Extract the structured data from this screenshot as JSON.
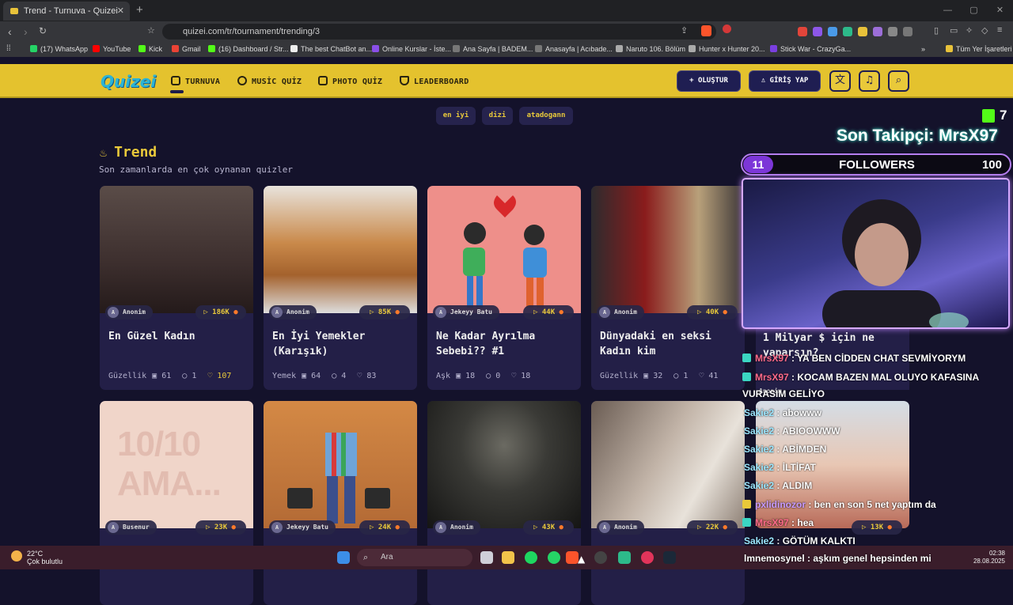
{
  "browser": {
    "tab_title": "Trend - Turnuva - Quizei",
    "tab_close": "✕",
    "new_tab": "+",
    "url": "quizei.com/tr/tournament/trending/3",
    "bookmarks": [
      "(17) WhatsApp",
      "YouTube",
      "Kick",
      "Gmail",
      "(16) Dashboard / Str...",
      "The best ChatBot an...",
      "Online Kurslar - İste...",
      "Ana Sayfa | BADEM...",
      "Anasayfa | Acıbade...",
      "Naruto 106. Bölüm",
      "Hunter x Hunter 20...",
      "Stick War - CrazyGa..."
    ],
    "all_bookmarks": "Tüm Yer İşaretleri",
    "more": "»"
  },
  "site": {
    "logo": "Quizei",
    "nav": [
      "TURNUVA",
      "MUSİC QUİZ",
      "PHOTO QUİZ",
      "LEADERBOARD"
    ],
    "create_button": "+ OLUŞTUR",
    "login_button": "GİRİŞ YAP",
    "tags": [
      "en iyi",
      "dizi",
      "atadogann"
    ],
    "trend_title": "Trend",
    "trend_subtitle": "Son zamanlarda en çok oynanan quizler"
  },
  "cards": [
    {
      "author": "Anonim",
      "plays": "186K",
      "title": "En Güzel Kadın",
      "category": "Güzellik",
      "questions": "61",
      "comments": "1",
      "likes": "107",
      "likes_highlight": true,
      "color": "#4a3b3a"
    },
    {
      "author": "Anonim",
      "plays": "85K",
      "title": "En İyi Yemekler (Karışık)",
      "category": "Yemek",
      "questions": "64",
      "comments": "4",
      "likes": "83",
      "likes_highlight": false,
      "color": "#b27942"
    },
    {
      "author": "Jekeyy Batu",
      "plays": "44K",
      "title": "Ne Kadar Ayrılma Sebebi?? #1",
      "category": "Aşk",
      "questions": "18",
      "comments": "0",
      "likes": "18",
      "likes_highlight": false,
      "color": "#ee8f8a"
    },
    {
      "author": "Anonim",
      "plays": "40K",
      "title": "Dünyadaki en seksi Kadın kim",
      "category": "Güzellik",
      "questions": "32",
      "comments": "1",
      "likes": "41",
      "likes_highlight": false,
      "color": "#5d2a2a"
    },
    {
      "author": "Busenur",
      "plays": "23K",
      "title": "",
      "color": "#f0d5c9",
      "image_text": "10/10 AMA..."
    },
    {
      "author": "Jekeyy Batu",
      "plays": "24K",
      "title": "",
      "color": "#c27a3d"
    },
    {
      "author": "Anonim",
      "plays": "43K",
      "title": "",
      "color": "#2a2a28"
    },
    {
      "author": "Anonim",
      "plays": "22K",
      "title": "",
      "color": "#a89a8e"
    }
  ],
  "hidden_card": {
    "plays": "13K",
    "author": "Anonim",
    "title": "1 Milyar $ için ne yaparsın?"
  },
  "stream": {
    "kick_count": "7",
    "last_follower": "Son Takipçi: MrsX97",
    "followers_current": "11",
    "followers_label": "FOLLOWERS",
    "followers_goal": "100",
    "chat": [
      {
        "user": "MrsX97",
        "text": " : YA BEN CİDDEN CHAT SEVMİYORYM",
        "color": "#ff6a8a",
        "icon": "#3bd6c2"
      },
      {
        "user": "MrsX97",
        "text": " : KOCAM BAZEN MAL OLUYO KAFASINA",
        "color": "#ff6a8a",
        "icon": "#3bd6c2"
      },
      {
        "user": "",
        "text": "VURASIM GELİYO",
        "color": "#ffffff",
        "icon": ""
      },
      {
        "user": "Sakie2",
        "text": " : abowww",
        "color": "#9be7ff",
        "icon": ""
      },
      {
        "user": "Sakie2",
        "text": " : ABIOOWWW",
        "color": "#9be7ff",
        "icon": ""
      },
      {
        "user": "Sakie2",
        "text": " : ABİMDEN",
        "color": "#9be7ff",
        "icon": ""
      },
      {
        "user": "Sakie2",
        "text": " : İLTİFAT",
        "color": "#9be7ff",
        "icon": ""
      },
      {
        "user": "Sakie2",
        "text": " : ALDIM",
        "color": "#9be7ff",
        "icon": ""
      },
      {
        "user": "pxlidinozor",
        "text": " : ben en son 5 net yaptım da",
        "color": "#c79bff",
        "icon": "#e9c93a"
      },
      {
        "user": "MrsX97",
        "text": " : hea",
        "color": "#ff6a8a",
        "icon": "#3bd6c2"
      },
      {
        "user": "Sakie2",
        "text": " : GÖTÜM KALKTI",
        "color": "#9be7ff",
        "icon": ""
      },
      {
        "user": "lmnemosynel",
        "text": " : aşkım genel hepsinden mi",
        "color": "#ffffff",
        "icon": ""
      }
    ]
  },
  "taskbar": {
    "temp": "22°C",
    "weather": "Çok bulutlu",
    "search": "Ara",
    "time": "02:38",
    "date": "28.08.2025"
  },
  "colors": {
    "accent": "#e4c22e",
    "background": "#14122b",
    "card": "#231f47",
    "follower_glow": "#3bd6c2"
  }
}
